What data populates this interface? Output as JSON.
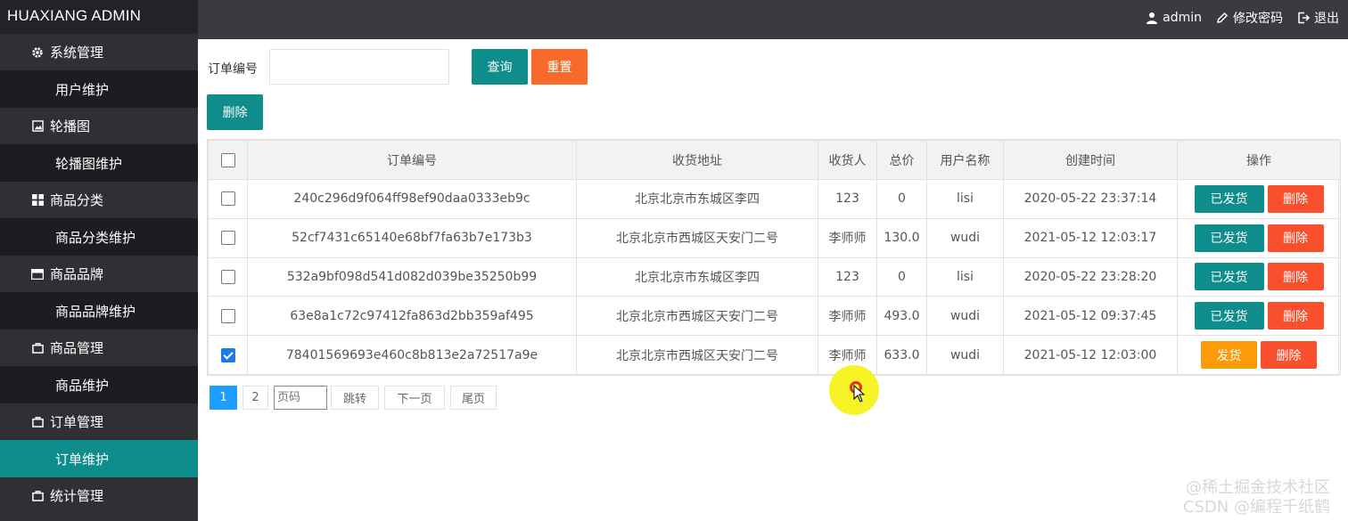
{
  "app": {
    "title": "HUAXIANG ADMIN"
  },
  "topbar": {
    "user": "admin",
    "change_password": "修改密码",
    "logout": "退出"
  },
  "sidebar": {
    "groups": [
      {
        "label": "系统管理",
        "icon": "gear-icon",
        "sub": "用户维护"
      },
      {
        "label": "轮播图",
        "icon": "image-icon",
        "sub": "轮播图维护"
      },
      {
        "label": "商品分类",
        "icon": "grid-icon",
        "sub": "商品分类维护"
      },
      {
        "label": "商品品牌",
        "icon": "card-icon",
        "sub": "商品品牌维护"
      },
      {
        "label": "商品管理",
        "icon": "bag-icon",
        "sub": "商品维护"
      },
      {
        "label": "订单管理",
        "icon": "bag-icon",
        "sub": "订单维护"
      },
      {
        "label": "统计管理",
        "icon": "bag-icon"
      }
    ],
    "active_sub": "订单维护"
  },
  "search": {
    "label": "订单编号",
    "value": "",
    "query_button": "查询",
    "reset_button": "重置"
  },
  "toolbar": {
    "delete_button": "删除"
  },
  "table": {
    "columns": [
      "订单编号",
      "收货地址",
      "收货人",
      "总价",
      "用户名称",
      "创建时间",
      "操作"
    ],
    "rows": [
      {
        "checked": false,
        "order_no": "240c296d9f064ff98ef90daa0333eb9c",
        "address": "北京北京市东城区李四",
        "receiver": "123",
        "total": "0",
        "user": "lisi",
        "created": "2020-05-22 23:37:14",
        "action": "已发货",
        "delete": "删除"
      },
      {
        "checked": false,
        "order_no": "52cf7431c65140e68bf7fa63b7e173b3",
        "address": "北京北京市西城区天安门二号",
        "receiver": "李师师",
        "total": "130.0",
        "user": "wudi",
        "created": "2021-05-12 12:03:17",
        "action": "已发货",
        "delete": "删除"
      },
      {
        "checked": false,
        "order_no": "532a9bf098d541d082d039be35250b99",
        "address": "北京北京市东城区李四",
        "receiver": "123",
        "total": "0",
        "user": "lisi",
        "created": "2020-05-22 23:28:20",
        "action": "已发货",
        "delete": "删除"
      },
      {
        "checked": false,
        "order_no": "63e8a1c72c97412fa863d2bb359af495",
        "address": "北京北京市西城区天安门二号",
        "receiver": "李师师",
        "total": "493.0",
        "user": "wudi",
        "created": "2021-05-12 09:37:45",
        "action": "已发货",
        "delete": "删除"
      },
      {
        "checked": true,
        "order_no": "78401569693e460c8b813e2a72517a9e",
        "address": "北京北京市西城区天安门二号",
        "receiver": "李师师",
        "total": "633.0",
        "user": "wudi",
        "created": "2021-05-12 12:03:00",
        "action": "发货",
        "delete": "删除"
      }
    ]
  },
  "pagination": {
    "current": "1",
    "page2": "2",
    "page_input_placeholder": "页码",
    "jump": "跳转",
    "next": "下一页",
    "last": "尾页"
  },
  "watermark": {
    "line1": "@稀土掘金技术社区",
    "line2": "CSDN @编程千纸鹤"
  },
  "colors": {
    "primary": "#0f8c8c",
    "warning": "#f8692c",
    "danger": "#f8502c",
    "orange": "#fd9a09",
    "sidebar": "#2f3034"
  }
}
